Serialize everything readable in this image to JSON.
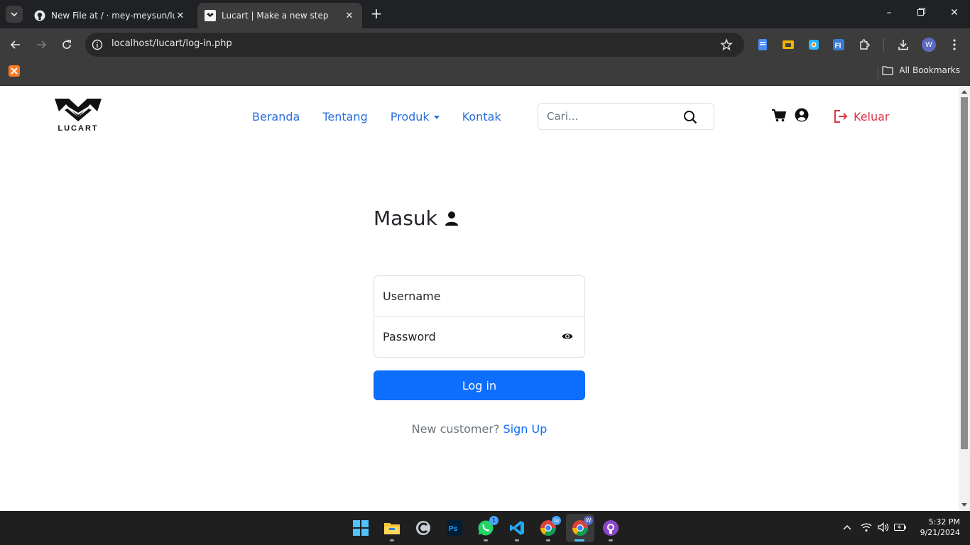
{
  "browser": {
    "tabs": [
      {
        "title": "New File at / · mey-meysun/luc"
      },
      {
        "title": "Lucart | Make a new step"
      }
    ],
    "url": "localhost/lucart/log-in.php",
    "bookmarks_label": "All Bookmarks",
    "profile_initial": "W"
  },
  "site": {
    "logo_text": "LUCART",
    "nav": {
      "home": "Beranda",
      "about": "Tentang",
      "products": "Produk",
      "contact": "Kontak"
    },
    "search_placeholder": "Cari...",
    "logout_label": "Keluar"
  },
  "login": {
    "title": "Masuk",
    "username_placeholder": "Username",
    "password_placeholder": "Password",
    "button_label": "Log in",
    "signup_prompt": "New customer?",
    "signup_link": "Sign Up"
  },
  "taskbar": {
    "time": "5:32 PM",
    "date": "9/21/2024",
    "whatsapp_badge": "1"
  },
  "colors": {
    "primary": "#0d6efd",
    "danger": "#dc3545",
    "chrome_dark": "#202124"
  }
}
